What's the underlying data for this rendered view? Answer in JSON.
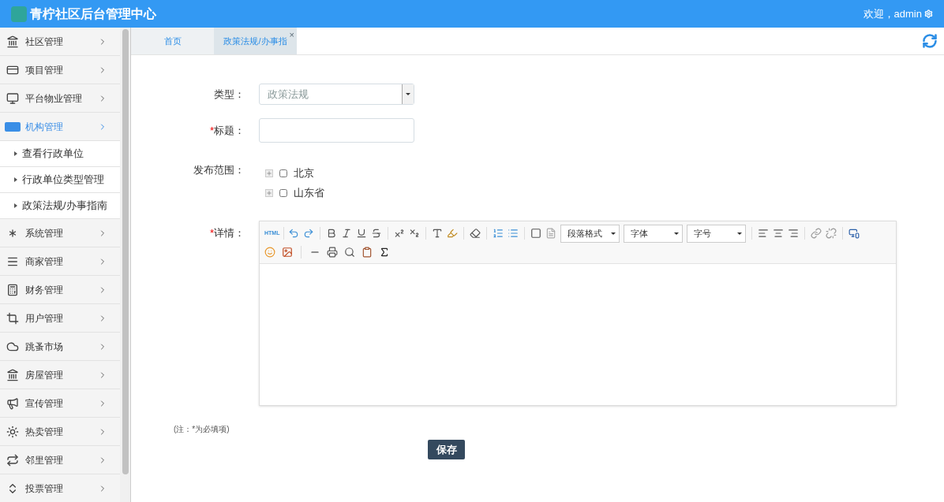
{
  "header": {
    "title": "青柠社区后台管理中心",
    "welcome": "欢迎，admin"
  },
  "sidebar": {
    "items": [
      {
        "label": "社区管理",
        "selected": false,
        "expanded": false
      },
      {
        "label": "项目管理",
        "selected": false,
        "expanded": false
      },
      {
        "label": "平台物业管理",
        "selected": false,
        "expanded": false
      },
      {
        "label": "机构管理",
        "selected": true,
        "expanded": true,
        "children": [
          {
            "label": "查看行政单位"
          },
          {
            "label": "行政单位类型管理"
          },
          {
            "label": "政策法规/办事指南"
          }
        ]
      },
      {
        "label": "系统管理",
        "selected": false,
        "expanded": false
      },
      {
        "label": "商家管理",
        "selected": false,
        "expanded": false
      },
      {
        "label": "财务管理",
        "selected": false,
        "expanded": false
      },
      {
        "label": "用户管理",
        "selected": false,
        "expanded": false
      },
      {
        "label": "跳蚤市场",
        "selected": false,
        "expanded": false
      },
      {
        "label": "房屋管理",
        "selected": false,
        "expanded": false
      },
      {
        "label": "宣传管理",
        "selected": false,
        "expanded": false
      },
      {
        "label": "热卖管理",
        "selected": false,
        "expanded": false
      },
      {
        "label": "邻里管理",
        "selected": false,
        "expanded": false
      },
      {
        "label": "投票管理",
        "selected": false,
        "expanded": false
      }
    ]
  },
  "tabs": [
    {
      "label": "首页",
      "selected": false
    },
    {
      "label": "政策法规/办事指",
      "selected": true,
      "close": "×"
    }
  ],
  "form": {
    "type": {
      "label": "类型：",
      "value": "政策法规"
    },
    "title": {
      "label": "标题：",
      "mark": "*"
    },
    "scope": {
      "label": "发布范围：",
      "options": [
        {
          "label": "北京",
          "checked": false
        },
        {
          "label": "山东省",
          "checked": false
        }
      ]
    },
    "detail": {
      "label": "详情：",
      "mark": "*",
      "html_label": "HTML",
      "dropdowns": [
        "段落格式",
        "字体",
        "字号"
      ]
    },
    "note": "(注：*为必填项)",
    "save": "保存"
  }
}
